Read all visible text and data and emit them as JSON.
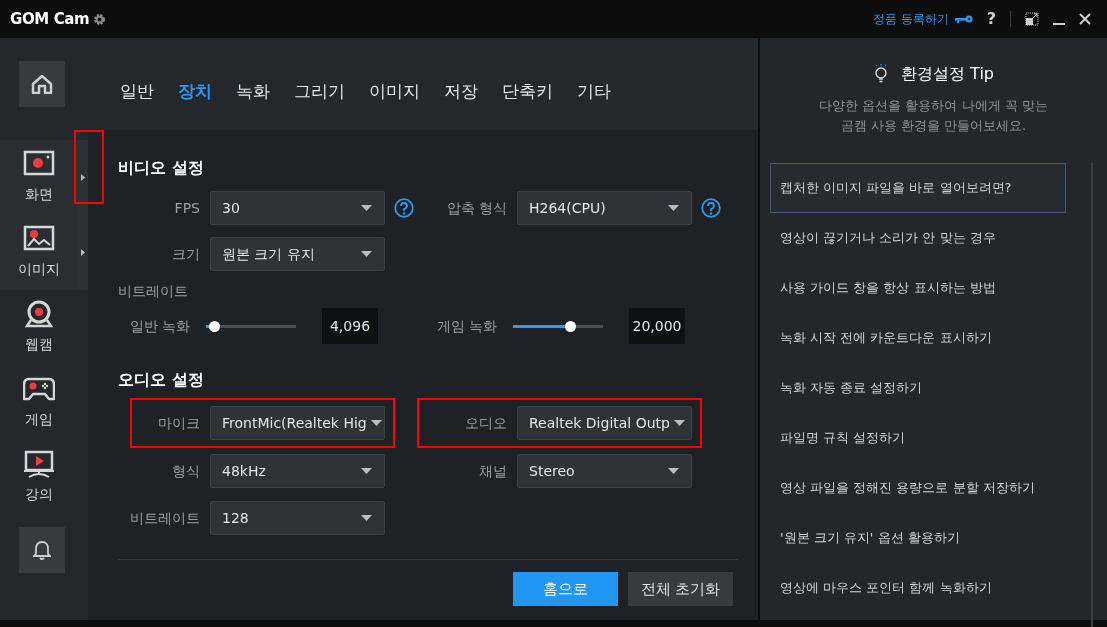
{
  "title_bar": {
    "app_name": "GOM Cam",
    "register_link": "정품 등록하기",
    "help": "?"
  },
  "sidebar": {
    "items": [
      {
        "label": "화면",
        "kind": "screen",
        "has_submenu": true,
        "highlighted": true
      },
      {
        "label": "이미지",
        "kind": "image",
        "has_submenu": true,
        "highlighted": false
      },
      {
        "label": "웹캠",
        "kind": "webcam",
        "has_submenu": false,
        "highlighted": false
      },
      {
        "label": "게임",
        "kind": "game",
        "has_submenu": false,
        "highlighted": false
      },
      {
        "label": "강의",
        "kind": "lecture",
        "has_submenu": false,
        "highlighted": false
      }
    ]
  },
  "tabs": [
    {
      "label": "일반",
      "selected": false
    },
    {
      "label": "장치",
      "selected": true
    },
    {
      "label": "녹화",
      "selected": false
    },
    {
      "label": "그리기",
      "selected": false
    },
    {
      "label": "이미지",
      "selected": false
    },
    {
      "label": "저장",
      "selected": false
    },
    {
      "label": "단축키",
      "selected": false
    },
    {
      "label": "기타",
      "selected": false
    }
  ],
  "video_settings": {
    "title": "비디오 설정",
    "fps": {
      "label": "FPS",
      "value": "30"
    },
    "codec": {
      "label": "압축 형식",
      "value": "H264(CPU)"
    },
    "size": {
      "label": "크기",
      "value": "원본 크기 유지"
    },
    "bitrate_label": "비트레이트",
    "normal_recording": {
      "label": "일반 녹화",
      "level": 0.09,
      "reading": "4,096"
    },
    "game_recording": {
      "label": "게임 녹화",
      "level": 0.63,
      "reading": "20,000"
    }
  },
  "audio_settings": {
    "title": "오디오 설정",
    "mic": {
      "label": "마이크",
      "value": "FrontMic(Realtek Hig",
      "highlighted": true
    },
    "audio": {
      "label": "오디오",
      "value": "Realtek Digital Outp",
      "highlighted": true
    },
    "format": {
      "label": "형식",
      "value": "48kHz"
    },
    "channel": {
      "label": "채널",
      "value": "Stereo"
    },
    "bitrate": {
      "label": "비트레이트",
      "value": "128"
    }
  },
  "buttons": [
    {
      "label": "홈으로",
      "kind": "primary"
    },
    {
      "label": "전체 초기화",
      "kind": "secondary"
    }
  ],
  "tip_panel": {
    "title": "환경설정 Tip",
    "subtitle": "다양한 옵션을 활용하여 나에게 꼭 맞는\n곰캠 사용 환경을 만들어보세요.",
    "items": [
      {
        "label": "캡처한 이미지 파일을 바로 열어보려면?",
        "selected": true
      },
      {
        "label": "영상이 끊기거나 소리가 안 맞는 경우",
        "selected": false
      },
      {
        "label": "사용 가이드 창을 항상 표시하는 방법",
        "selected": false
      },
      {
        "label": "녹화 시작 전에 카운트다운 표시하기",
        "selected": false
      },
      {
        "label": "녹화 자동 종료 설정하기",
        "selected": false
      },
      {
        "label": "파일명 규칙 설정하기",
        "selected": false
      },
      {
        "label": "영상 파일을 정해진 용량으로 분할 저장하기",
        "selected": false
      },
      {
        "label": "'원본 크기 유지' 옵션 활용하기",
        "selected": false
      },
      {
        "label": "영상에 마우스 포인터 함께 녹화하기",
        "selected": false
      }
    ]
  }
}
